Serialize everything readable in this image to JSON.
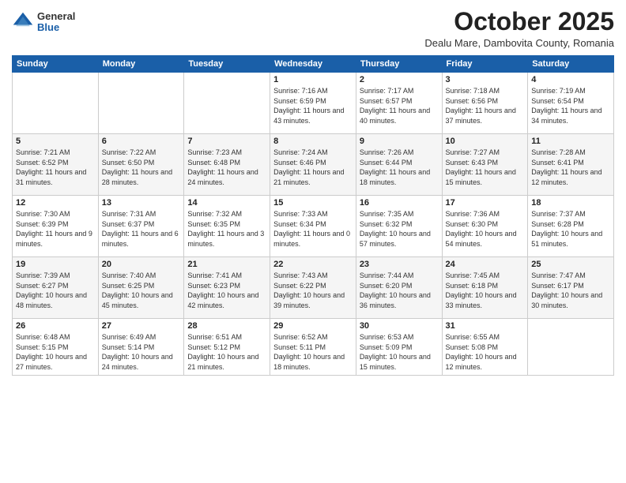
{
  "logo": {
    "general": "General",
    "blue": "Blue"
  },
  "title": "October 2025",
  "subtitle": "Dealu Mare, Dambovita County, Romania",
  "weekdays": [
    "Sunday",
    "Monday",
    "Tuesday",
    "Wednesday",
    "Thursday",
    "Friday",
    "Saturday"
  ],
  "weeks": [
    [
      {
        "day": "",
        "info": ""
      },
      {
        "day": "",
        "info": ""
      },
      {
        "day": "",
        "info": ""
      },
      {
        "day": "1",
        "info": "Sunrise: 7:16 AM\nSunset: 6:59 PM\nDaylight: 11 hours and 43 minutes."
      },
      {
        "day": "2",
        "info": "Sunrise: 7:17 AM\nSunset: 6:57 PM\nDaylight: 11 hours and 40 minutes."
      },
      {
        "day": "3",
        "info": "Sunrise: 7:18 AM\nSunset: 6:56 PM\nDaylight: 11 hours and 37 minutes."
      },
      {
        "day": "4",
        "info": "Sunrise: 7:19 AM\nSunset: 6:54 PM\nDaylight: 11 hours and 34 minutes."
      }
    ],
    [
      {
        "day": "5",
        "info": "Sunrise: 7:21 AM\nSunset: 6:52 PM\nDaylight: 11 hours and 31 minutes."
      },
      {
        "day": "6",
        "info": "Sunrise: 7:22 AM\nSunset: 6:50 PM\nDaylight: 11 hours and 28 minutes."
      },
      {
        "day": "7",
        "info": "Sunrise: 7:23 AM\nSunset: 6:48 PM\nDaylight: 11 hours and 24 minutes."
      },
      {
        "day": "8",
        "info": "Sunrise: 7:24 AM\nSunset: 6:46 PM\nDaylight: 11 hours and 21 minutes."
      },
      {
        "day": "9",
        "info": "Sunrise: 7:26 AM\nSunset: 6:44 PM\nDaylight: 11 hours and 18 minutes."
      },
      {
        "day": "10",
        "info": "Sunrise: 7:27 AM\nSunset: 6:43 PM\nDaylight: 11 hours and 15 minutes."
      },
      {
        "day": "11",
        "info": "Sunrise: 7:28 AM\nSunset: 6:41 PM\nDaylight: 11 hours and 12 minutes."
      }
    ],
    [
      {
        "day": "12",
        "info": "Sunrise: 7:30 AM\nSunset: 6:39 PM\nDaylight: 11 hours and 9 minutes."
      },
      {
        "day": "13",
        "info": "Sunrise: 7:31 AM\nSunset: 6:37 PM\nDaylight: 11 hours and 6 minutes."
      },
      {
        "day": "14",
        "info": "Sunrise: 7:32 AM\nSunset: 6:35 PM\nDaylight: 11 hours and 3 minutes."
      },
      {
        "day": "15",
        "info": "Sunrise: 7:33 AM\nSunset: 6:34 PM\nDaylight: 11 hours and 0 minutes."
      },
      {
        "day": "16",
        "info": "Sunrise: 7:35 AM\nSunset: 6:32 PM\nDaylight: 10 hours and 57 minutes."
      },
      {
        "day": "17",
        "info": "Sunrise: 7:36 AM\nSunset: 6:30 PM\nDaylight: 10 hours and 54 minutes."
      },
      {
        "day": "18",
        "info": "Sunrise: 7:37 AM\nSunset: 6:28 PM\nDaylight: 10 hours and 51 minutes."
      }
    ],
    [
      {
        "day": "19",
        "info": "Sunrise: 7:39 AM\nSunset: 6:27 PM\nDaylight: 10 hours and 48 minutes."
      },
      {
        "day": "20",
        "info": "Sunrise: 7:40 AM\nSunset: 6:25 PM\nDaylight: 10 hours and 45 minutes."
      },
      {
        "day": "21",
        "info": "Sunrise: 7:41 AM\nSunset: 6:23 PM\nDaylight: 10 hours and 42 minutes."
      },
      {
        "day": "22",
        "info": "Sunrise: 7:43 AM\nSunset: 6:22 PM\nDaylight: 10 hours and 39 minutes."
      },
      {
        "day": "23",
        "info": "Sunrise: 7:44 AM\nSunset: 6:20 PM\nDaylight: 10 hours and 36 minutes."
      },
      {
        "day": "24",
        "info": "Sunrise: 7:45 AM\nSunset: 6:18 PM\nDaylight: 10 hours and 33 minutes."
      },
      {
        "day": "25",
        "info": "Sunrise: 7:47 AM\nSunset: 6:17 PM\nDaylight: 10 hours and 30 minutes."
      }
    ],
    [
      {
        "day": "26",
        "info": "Sunrise: 6:48 AM\nSunset: 5:15 PM\nDaylight: 10 hours and 27 minutes."
      },
      {
        "day": "27",
        "info": "Sunrise: 6:49 AM\nSunset: 5:14 PM\nDaylight: 10 hours and 24 minutes."
      },
      {
        "day": "28",
        "info": "Sunrise: 6:51 AM\nSunset: 5:12 PM\nDaylight: 10 hours and 21 minutes."
      },
      {
        "day": "29",
        "info": "Sunrise: 6:52 AM\nSunset: 5:11 PM\nDaylight: 10 hours and 18 minutes."
      },
      {
        "day": "30",
        "info": "Sunrise: 6:53 AM\nSunset: 5:09 PM\nDaylight: 10 hours and 15 minutes."
      },
      {
        "day": "31",
        "info": "Sunrise: 6:55 AM\nSunset: 5:08 PM\nDaylight: 10 hours and 12 minutes."
      },
      {
        "day": "",
        "info": ""
      }
    ]
  ]
}
